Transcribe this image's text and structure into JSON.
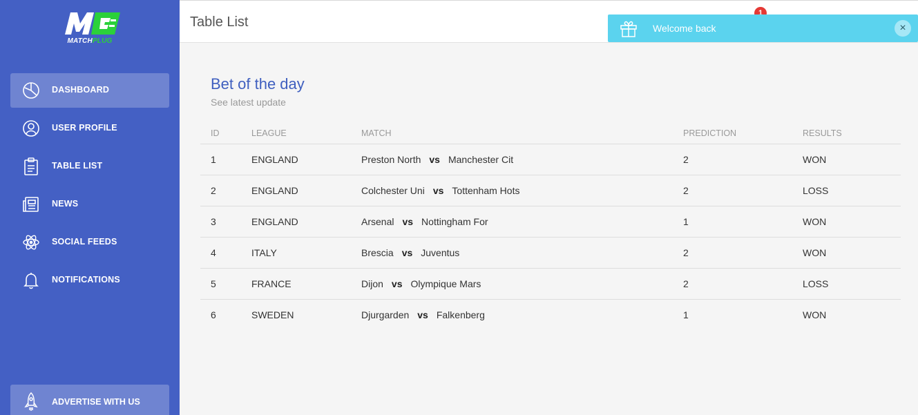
{
  "brand": {
    "logo_text_part1": "MATCH",
    "logo_text_part2": "PLUG",
    "primary_color": "#4460c4",
    "accent_color": "#2bd13a"
  },
  "sidebar": {
    "items": [
      {
        "label": "DASHBOARD",
        "icon": "pie-chart-icon",
        "active": true
      },
      {
        "label": "USER PROFILE",
        "icon": "user-icon",
        "active": false
      },
      {
        "label": "TABLE LIST",
        "icon": "clipboard-icon",
        "active": false
      },
      {
        "label": "NEWS",
        "icon": "newspaper-icon",
        "active": false
      },
      {
        "label": "SOCIAL FEEDS",
        "icon": "atom-icon",
        "active": false
      },
      {
        "label": "NOTIFICATIONS",
        "icon": "bell-icon",
        "active": false
      }
    ],
    "advertise": {
      "label": "ADVERTISE WITH US",
      "icon": "rocket-icon"
    }
  },
  "header": {
    "title": "Table List",
    "notification_count": "1"
  },
  "toast": {
    "message": "Welcome back",
    "icon": "gift-icon",
    "close_label": "×",
    "color": "#5bd3ee"
  },
  "card": {
    "title": "Bet of the day",
    "subtitle": "See latest update"
  },
  "table": {
    "columns": [
      "ID",
      "LEAGUE",
      "MATCH",
      "PREDICTION",
      "RESULTS"
    ],
    "vs_label": "vs",
    "rows": [
      {
        "id": "1",
        "league": "ENGLAND",
        "home": "Preston North",
        "away": "Manchester Cit",
        "prediction": "2",
        "result": "WON"
      },
      {
        "id": "2",
        "league": "ENGLAND",
        "home": "Colchester Uni",
        "away": "Tottenham Hots",
        "prediction": "2",
        "result": "LOSS"
      },
      {
        "id": "3",
        "league": "ENGLAND",
        "home": "Arsenal",
        "away": "Nottingham For",
        "prediction": "1",
        "result": "WON"
      },
      {
        "id": "4",
        "league": "ITALY",
        "home": "Brescia",
        "away": "Juventus",
        "prediction": "2",
        "result": "WON"
      },
      {
        "id": "5",
        "league": "FRANCE",
        "home": "Dijon",
        "away": "Olympique Mars",
        "prediction": "2",
        "result": "LOSS"
      },
      {
        "id": "6",
        "league": "SWEDEN",
        "home": "Djurgarden",
        "away": "Falkenberg",
        "prediction": "1",
        "result": "WON"
      }
    ]
  }
}
